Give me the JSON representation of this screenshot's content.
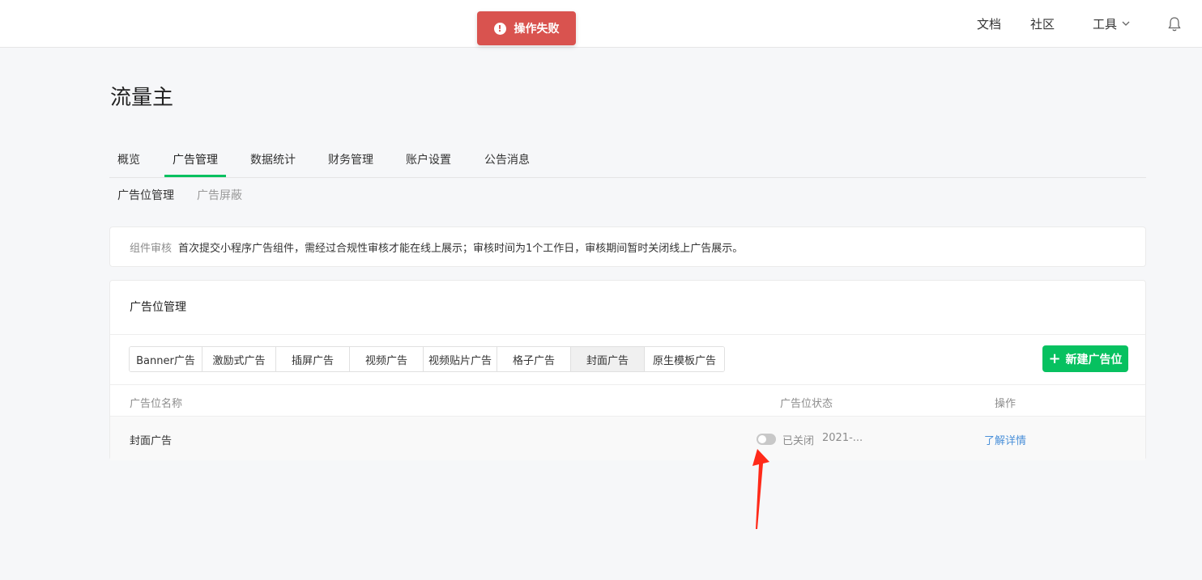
{
  "toast": {
    "text": "操作失败",
    "icon": "exclamation-icon",
    "color": "#d9534f"
  },
  "topnav": {
    "docs": "文档",
    "community": "社区",
    "tools": "工具"
  },
  "page": {
    "title": "流量主"
  },
  "tabs": [
    {
      "label": "概览"
    },
    {
      "label": "广告管理",
      "active": true
    },
    {
      "label": "数据统计"
    },
    {
      "label": "财务管理"
    },
    {
      "label": "账户设置"
    },
    {
      "label": "公告消息"
    }
  ],
  "subtabs": [
    {
      "label": "广告位管理",
      "active": true
    },
    {
      "label": "广告屏蔽"
    }
  ],
  "notice": {
    "label": "组件审核",
    "text": "首次提交小程序广告组件，需经过合规性审核才能在线上展示；审核时间为1个工作日，审核期间暂时关闭线上广告展示。"
  },
  "card": {
    "title": "广告位管理",
    "segments": [
      "Banner广告",
      "激励式广告",
      "插屏广告",
      "视频广告",
      "视频贴片广告",
      "格子广告",
      "封面广告",
      "原生模板广告"
    ],
    "active_segment": "封面广告",
    "new_button": "新建广告位",
    "table": {
      "headers": {
        "name": "广告位名称",
        "status": "广告位状态",
        "action": "操作"
      },
      "rows": [
        {
          "name": "封面广告",
          "switch_on": false,
          "status": "已关闭",
          "date": "2021-...",
          "action": "了解详情"
        }
      ]
    }
  },
  "colors": {
    "accent": "#07c160",
    "link": "#4a90d9",
    "annotation_arrow": "#ff2a1a"
  }
}
